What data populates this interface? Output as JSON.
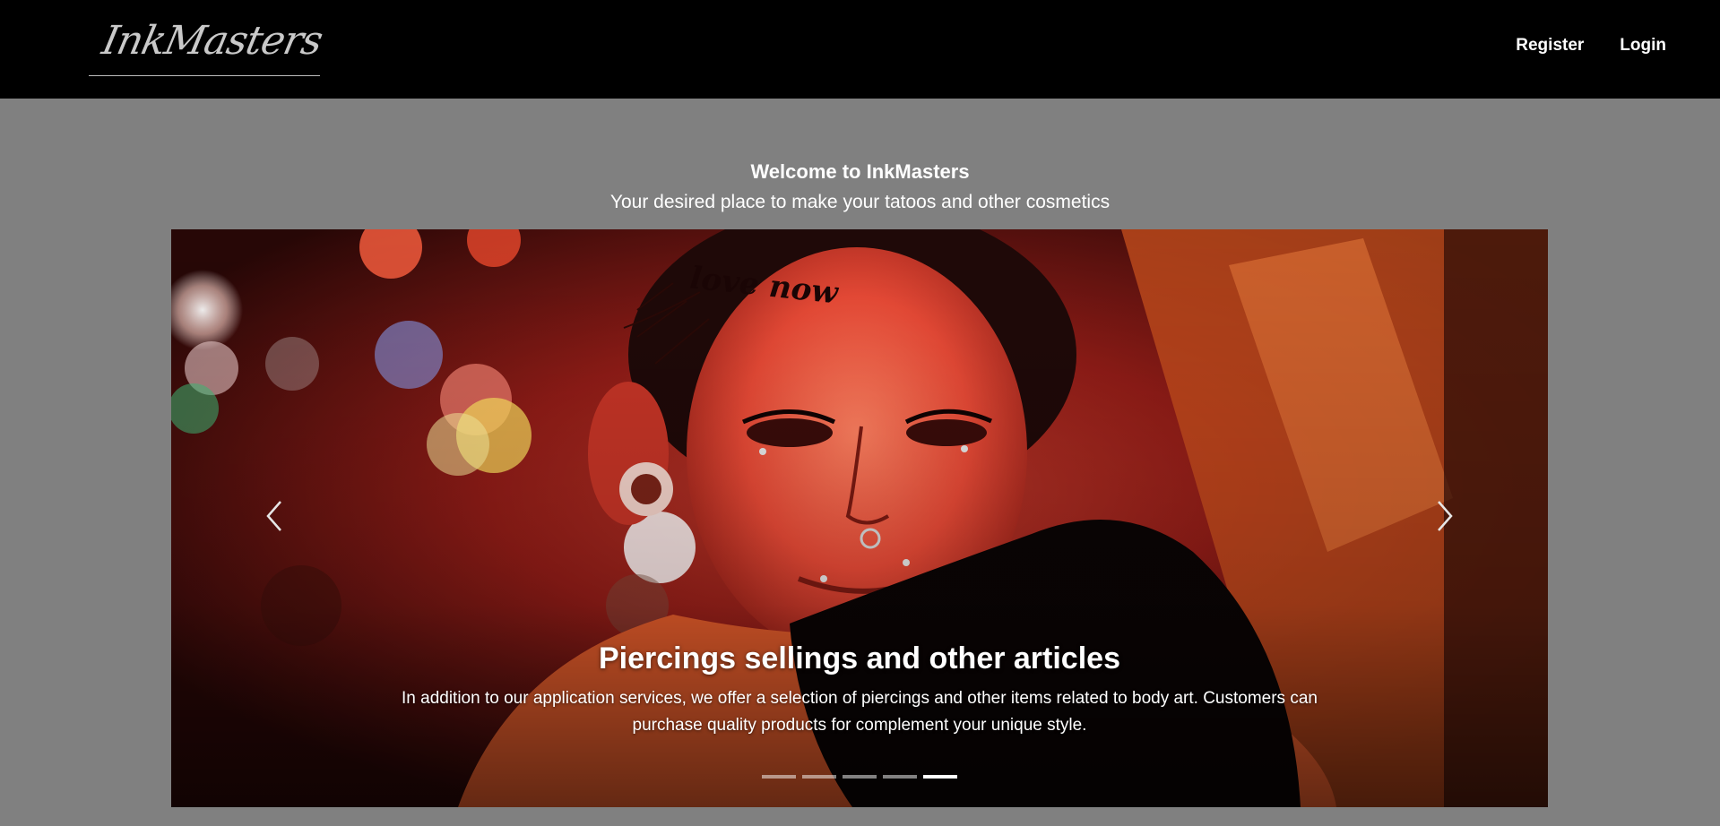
{
  "header": {
    "logo_text": "InkMasters",
    "nav": {
      "register_label": "Register",
      "login_label": "Login"
    }
  },
  "welcome": {
    "title": "Welcome to InkMasters",
    "subtitle": "Your desired place to make your tatoos and other cosmetics"
  },
  "carousel": {
    "slide_count": 5,
    "active_index": 4,
    "caption": {
      "title": "Piercings sellings and other articles",
      "text": "In addition to our application services, we offer a selection of piercings and other items related to body art. Customers can purchase quality products for complement your unique style."
    },
    "prev_icon": "chevron-left-icon",
    "next_icon": "chevron-right-icon"
  },
  "colors": {
    "navbar_bg": "#000000",
    "page_bg": "#808080",
    "text": "#ffffff"
  }
}
